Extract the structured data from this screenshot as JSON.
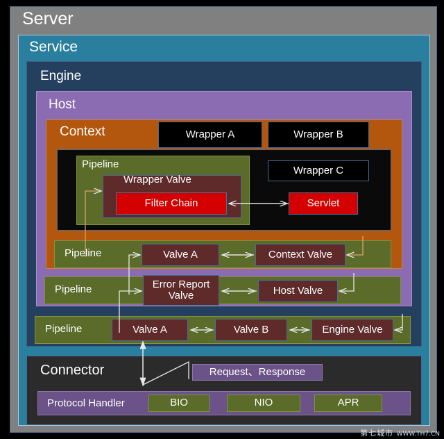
{
  "diagram": {
    "server": {
      "label": "Server"
    },
    "service": {
      "label": "Service"
    },
    "engine": {
      "label": "Engine"
    },
    "host": {
      "label": "Host"
    },
    "context": {
      "label": "Context"
    },
    "wrappers": [
      {
        "label": "Wrapper A"
      },
      {
        "label": "Wrapper B"
      },
      {
        "label": "Wrapper C"
      }
    ],
    "wrapper_pipeline": {
      "label": "Pipeline",
      "valve": "Wrapper Valve",
      "filter_chain": "Filter Chain"
    },
    "servlet": {
      "label": "Servlet"
    },
    "pipelines": [
      {
        "label": "Pipeline",
        "scope": "context",
        "valves": [
          {
            "label": "Valve A"
          },
          {
            "label": "Context Valve"
          }
        ]
      },
      {
        "label": "Pipeline",
        "scope": "host",
        "valves": [
          {
            "label": "Error Report Valve"
          },
          {
            "label": "Host Valve"
          }
        ]
      },
      {
        "label": "Pipeline",
        "scope": "engine",
        "valves": [
          {
            "label": "Valve A"
          },
          {
            "label": "Valve B"
          },
          {
            "label": "Engine Valve"
          }
        ]
      }
    ],
    "connector": {
      "label": "Connector",
      "request_response": "Request、Response",
      "protocol_handler": "Protocol Handler",
      "protocols": [
        {
          "label": "BIO"
        },
        {
          "label": "NIO"
        },
        {
          "label": "APR"
        }
      ]
    },
    "watermark": {
      "site": "第七城市",
      "url": "WWW.TH7.CN"
    },
    "colors": {
      "server": "#808080",
      "service": "#2a7f9e",
      "engine": "#24405e",
      "host": "#8b6bb1",
      "context": "#b3570e",
      "pipeline": "#5a6b2a",
      "valve": "#5e2a2a",
      "highlight": "#d40000",
      "wrapper": "#000000",
      "connector": "#2b2b2b",
      "protocol_handler": "#6b5288",
      "border": "#4a6d96",
      "arrow": "#e8e8e8"
    }
  }
}
